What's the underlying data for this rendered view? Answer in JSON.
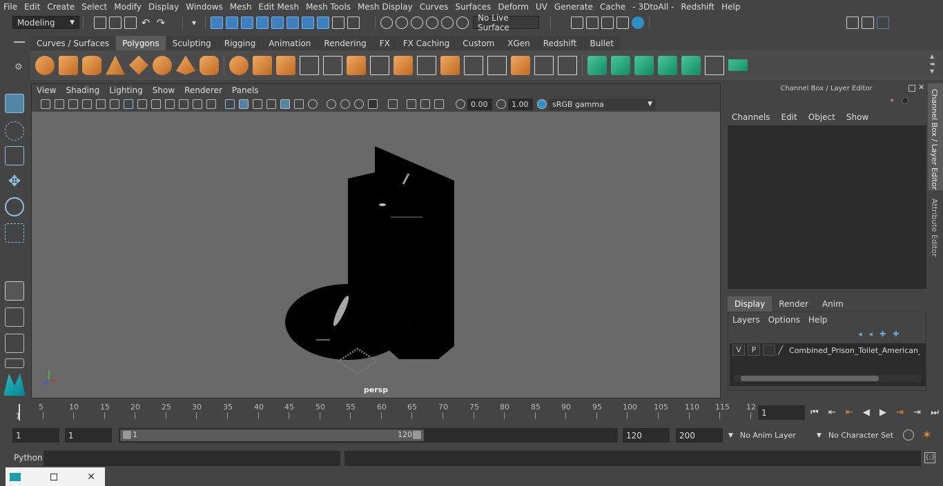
{
  "menus": [
    "File",
    "Edit",
    "Create",
    "Select",
    "Modify",
    "Display",
    "Windows",
    "Mesh",
    "Edit Mesh",
    "Mesh Tools",
    "Mesh Display",
    "Curves",
    "Surfaces",
    "Deform",
    "UV",
    "Generate",
    "Cache",
    "- 3DtoAll -",
    "Redshift",
    "Help"
  ],
  "status": {
    "mode": "Modeling",
    "live_surface": "No Live Surface"
  },
  "shelf_tabs": [
    {
      "label": "Curves / Surfaces"
    },
    {
      "label": "Polygons",
      "active": true
    },
    {
      "label": "Sculpting"
    },
    {
      "label": "Rigging"
    },
    {
      "label": "Animation"
    },
    {
      "label": "Rendering"
    },
    {
      "label": "FX"
    },
    {
      "label": "FX Caching"
    },
    {
      "label": "Custom"
    },
    {
      "label": "XGen"
    },
    {
      "label": "Redshift"
    },
    {
      "label": "Bullet"
    }
  ],
  "viewport": {
    "menus": [
      "View",
      "Shading",
      "Lighting",
      "Show",
      "Renderer",
      "Panels"
    ],
    "exposure": "0.00",
    "gamma": "1.00",
    "color_space": "sRGB gamma",
    "camera_label": "persp"
  },
  "channel_box": {
    "title": "Channel Box / Layer Editor",
    "menus": [
      "Channels",
      "Edit",
      "Object",
      "Show"
    ],
    "side_tabs": [
      "Channel Box / Layer Editor",
      "Attribute Editor"
    ]
  },
  "layer_editor": {
    "tabs": [
      "Display",
      "Render",
      "Anim"
    ],
    "menus": [
      "Layers",
      "Options",
      "Help"
    ],
    "layer": {
      "v": "V",
      "p": "P",
      "name": "Combined_Prison_Toilet_American_St"
    }
  },
  "timeline": {
    "ticks": [
      "5",
      "10",
      "15",
      "20",
      "25",
      "30",
      "35",
      "40",
      "45",
      "50",
      "55",
      "60",
      "65",
      "70",
      "75",
      "80",
      "85",
      "90",
      "95",
      "100",
      "105",
      "110",
      "115",
      "12"
    ],
    "current_frame": "1",
    "start_marker": "1"
  },
  "range": {
    "start": "1",
    "start2": "1",
    "slider_start": "1",
    "slider_end": "120",
    "end": "120",
    "end2": "200",
    "anim_layer": "No Anim Layer",
    "character_set": "No Character Set"
  },
  "command_line": {
    "label": "Python"
  },
  "colors": {
    "accent": "#5285a6",
    "panel": "#444444",
    "viewport": "#696969"
  }
}
